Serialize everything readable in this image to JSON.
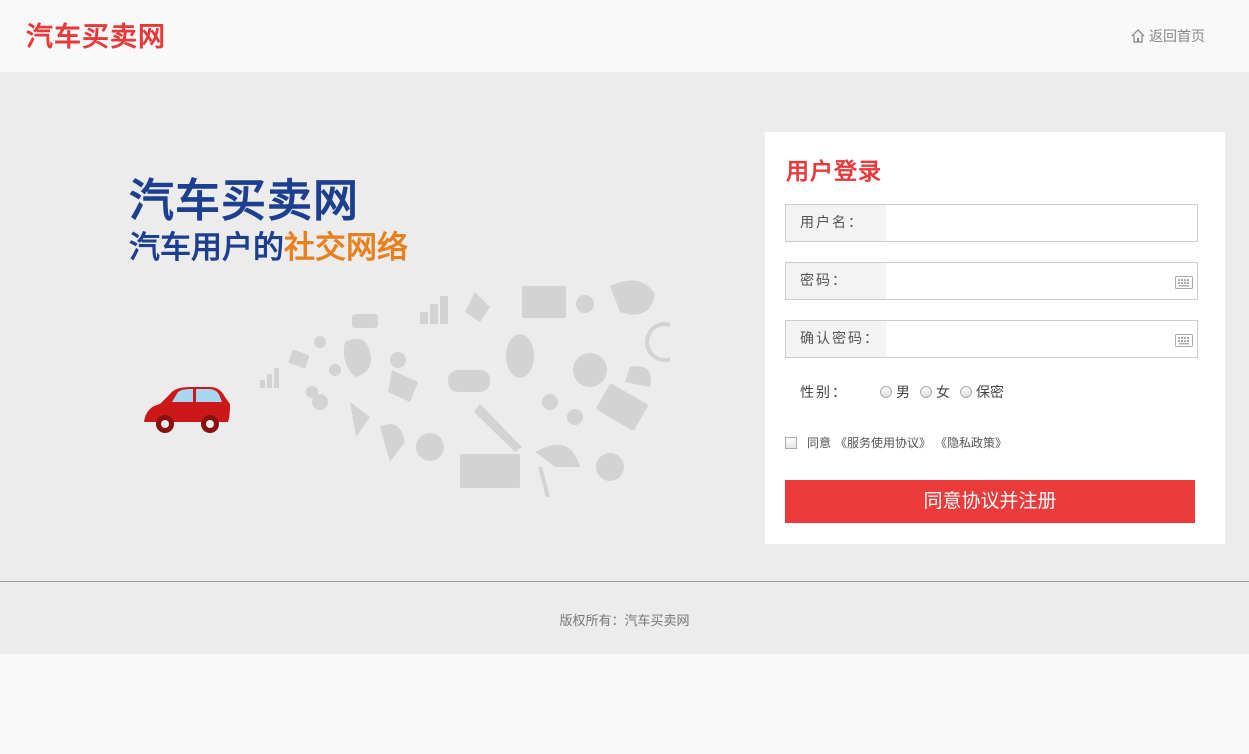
{
  "header": {
    "logo": "汽车买卖网",
    "home_link": "返回首页",
    "home_icon": "home-icon"
  },
  "banner": {
    "title": "汽车买卖网",
    "subtitle_part1": "汽车用户的",
    "subtitle_part2": "社交网络"
  },
  "login": {
    "title": "用户登录",
    "username_label": "用户名：",
    "password_label": "密码：",
    "confirm_label": "确认密码：",
    "gender_label": "性别：",
    "gender_options": [
      "男",
      "女",
      "保密"
    ],
    "agree_text": "同意",
    "terms_link": "《服务使用协议》",
    "privacy_link": "《隐私政策》",
    "submit_label": "同意协议并注册"
  },
  "footer": {
    "copyright": "版权所有：汽车买卖网"
  },
  "colors": {
    "brand_red": "#e8393a",
    "navy": "#1c3f8f",
    "orange": "#e8801e",
    "button": "#ed3a3a"
  }
}
